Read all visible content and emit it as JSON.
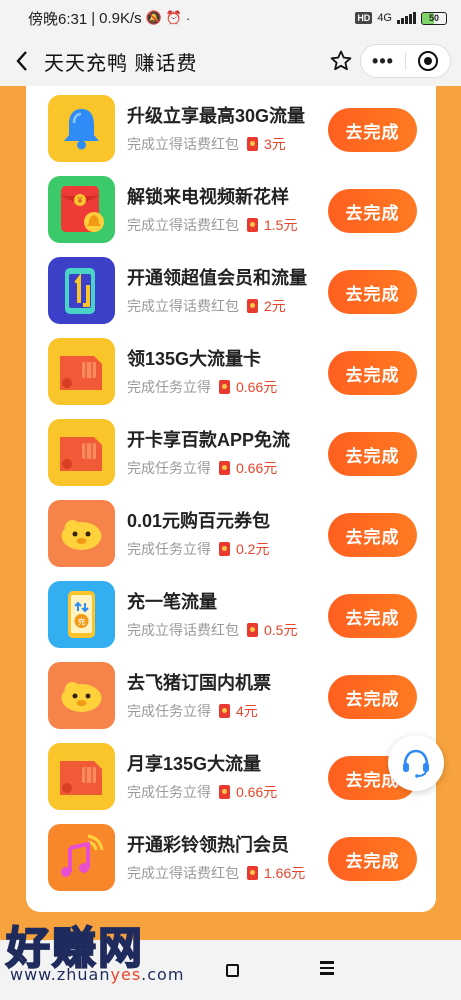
{
  "statusbar": {
    "time": "傍晚6:31",
    "speed": "0.9K/s",
    "network": "4G",
    "battery": "50"
  },
  "navbar": {
    "title": "天天充鸭 赚话费",
    "more": "•••"
  },
  "tasks": [
    {
      "name": "升级立享最高30G流量",
      "desc": "完成立得话费红包",
      "amount": "3元",
      "button": "去完成",
      "icon": "bell-icon"
    },
    {
      "name": "解锁来电视频新花样",
      "desc": "完成立得话费红包",
      "amount": "1.5元",
      "button": "去完成",
      "icon": "red-envelope-icon"
    },
    {
      "name": "开通领超值会员和流量",
      "desc": "完成立得话费红包",
      "amount": "2元",
      "button": "去完成",
      "icon": "phone-app-icon"
    },
    {
      "name": "领135G大流量卡",
      "desc": "完成任务立得",
      "amount": "0.66元",
      "button": "去完成",
      "icon": "sim-card-icon"
    },
    {
      "name": "开卡享百款APP免流",
      "desc": "完成任务立得",
      "amount": "0.66元",
      "button": "去完成",
      "icon": "sim-card-icon"
    },
    {
      "name": "0.01元购百元券包",
      "desc": "完成任务立得",
      "amount": "0.2元",
      "button": "去完成",
      "icon": "pig-icon"
    },
    {
      "name": "充一笔流量",
      "desc": "完成立得话费红包",
      "amount": "0.5元",
      "button": "去完成",
      "icon": "recharge-icon"
    },
    {
      "name": "去飞猪订国内机票",
      "desc": "完成任务立得",
      "amount": "4元",
      "button": "去完成",
      "icon": "pig-icon"
    },
    {
      "name": "月享135G大流量",
      "desc": "完成任务立得",
      "amount": "0.66元",
      "button": "去完成",
      "icon": "sim-card-icon"
    },
    {
      "name": "开通彩铃领热门会员",
      "desc": "完成立得话费红包",
      "amount": "1.66元",
      "button": "去完成",
      "icon": "music-note-icon"
    }
  ],
  "watermark": {
    "brand": "好赚网",
    "url_prefix": "www.zhuan",
    "url_highlight": "yes",
    "url_suffix": ".com"
  },
  "colors": {
    "page_bg": "#f6a23e",
    "button": "#ff6a20",
    "amount": "#e8452c"
  }
}
